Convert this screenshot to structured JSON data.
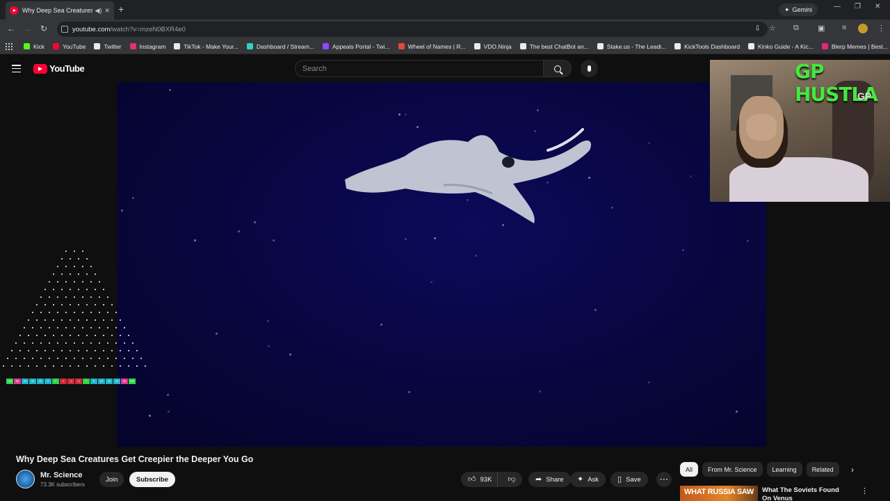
{
  "browser": {
    "tab_title": "Why Deep Sea Creatures G",
    "new_tab": "+",
    "gemini_label": "Gemini",
    "url_host": "youtube.com",
    "url_path": "/watch?v=mzeN0BXR4e0",
    "bookmarks": [
      {
        "label": "Kick",
        "color": "#53fc18"
      },
      {
        "label": "YouTube",
        "color": "#ff0033"
      },
      {
        "label": "Twitter",
        "color": "#e8eaed"
      },
      {
        "label": "Instagram",
        "color": "#e1306c"
      },
      {
        "label": "TikTok - Make Your...",
        "color": "#e8eaed"
      },
      {
        "label": "Dashboard / Stream...",
        "color": "#2dd4bf"
      },
      {
        "label": "Appeals Portal - Twi...",
        "color": "#9146ff"
      },
      {
        "label": "Wheel of Names | R...",
        "color": "#e0493c"
      },
      {
        "label": "VDO.Ninja",
        "color": "#e8eaed"
      },
      {
        "label": "The best ChatBot an...",
        "color": "#e8eaed"
      },
      {
        "label": "Stake.us - The Leadi...",
        "color": "#e8eaed"
      },
      {
        "label": "KickTools Dashboard",
        "color": "#e8eaed"
      },
      {
        "label": "Kinko Guide - A Kic...",
        "color": "#e8eaed"
      },
      {
        "label": "Blerp Memes | Best...",
        "color": "#e5267a"
      }
    ]
  },
  "youtube": {
    "logo_text": "YouTube",
    "search_placeholder": "Search",
    "video": {
      "title": "Why Deep Sea Creatures Get Creepier the Deeper You Go",
      "channel": "Mr. Science",
      "subscribers": "73.3K subscribers",
      "join_label": "Join",
      "subscribe_label": "Subscribe",
      "likes": "93K",
      "share_label": "Share",
      "ask_label": "Ask",
      "save_label": "Save"
    },
    "chips": [
      "All",
      "From Mr. Science",
      "Learning",
      "Related"
    ],
    "recommendation": {
      "thumb_text": "WHAT RUSSIA SAW",
      "title": "What The Soviets Found On Venus"
    }
  },
  "overlay": {
    "webcam_title": "GP HUSTLA",
    "webcam_badge": "GP",
    "plinko_slots": [
      "100",
      "50",
      "25",
      "20",
      "10",
      "5",
      "1",
      "1",
      "-2",
      "-3",
      "1",
      "5",
      "10",
      "20",
      "25",
      "50",
      "100"
    ]
  },
  "colors": {
    "accent": "#ff0033",
    "overlay_green": "#46e83e"
  }
}
